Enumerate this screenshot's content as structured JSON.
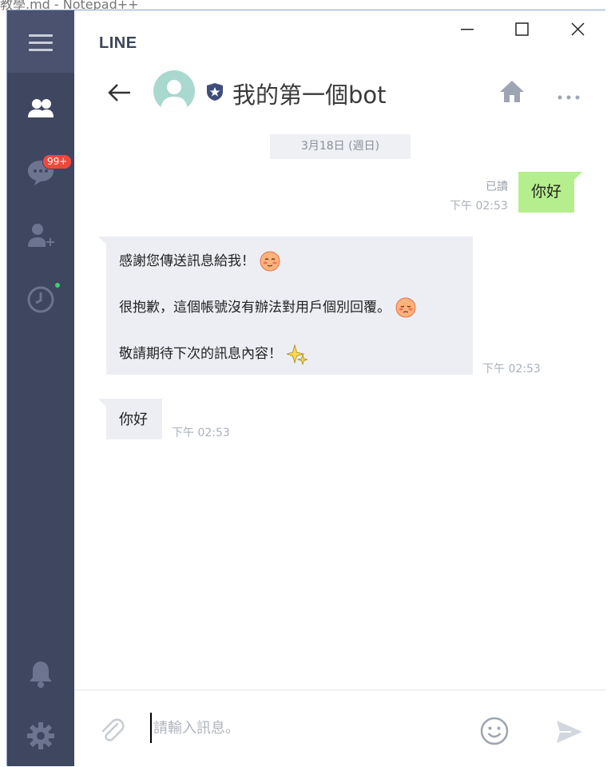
{
  "background_window": {
    "title": "教學.md - Notepad++"
  },
  "app": {
    "brand": "LINE"
  },
  "window_controls": {
    "minimize": "minimize",
    "maximize": "maximize",
    "close": "close"
  },
  "sidebar": {
    "items": [
      {
        "name": "menu",
        "icon": "hamburger-icon"
      },
      {
        "name": "friends",
        "icon": "friends-icon"
      },
      {
        "name": "chats",
        "icon": "chat-icon",
        "badge": "99+"
      },
      {
        "name": "add-friend",
        "icon": "add-friend-icon"
      },
      {
        "name": "timeline",
        "icon": "clock-icon"
      },
      {
        "name": "notifications",
        "icon": "bell-icon"
      },
      {
        "name": "settings",
        "icon": "gear-icon"
      }
    ]
  },
  "chat": {
    "title": "我的第一個bot",
    "date": "3月18日 (週日)",
    "messages": [
      {
        "direction": "out",
        "text": "你好",
        "read": "已讀",
        "time": "下午 02:53"
      },
      {
        "direction": "in",
        "lines": [
          "感謝您傳送訊息給我！",
          "很抱歉，這個帳號沒有辦法對用戶個別回覆。",
          "敬請期待下次的訊息內容！"
        ],
        "time": "下午 02:53"
      },
      {
        "direction": "in",
        "text": "你好",
        "time": "下午 02:53"
      }
    ]
  },
  "composer": {
    "placeholder": "請輸入訊息。"
  },
  "colors": {
    "sidebar": "#3f4660",
    "bubble_out": "#b5ee8c",
    "bubble_in": "#eceef3",
    "badge": "#f0483a"
  }
}
